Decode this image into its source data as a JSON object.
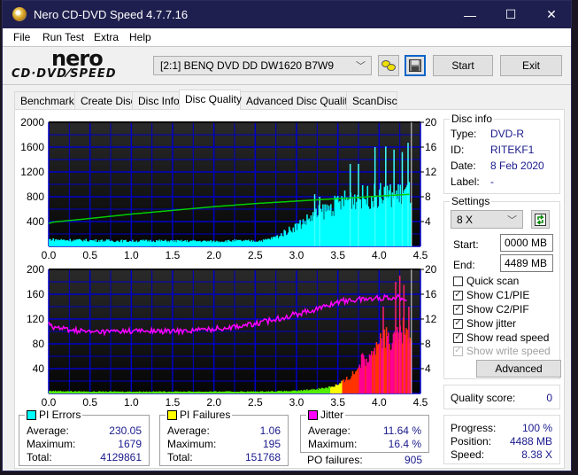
{
  "window": {
    "title": "Nero CD-DVD Speed 4.7.7.16",
    "controls": {
      "minimize": "—",
      "maximize": "☐",
      "close": "✕"
    }
  },
  "menu": [
    "File",
    "Run Test",
    "Extra",
    "Help"
  ],
  "logo": {
    "brand": "nero",
    "product": "CD·DVD⁄SPEED"
  },
  "toolbar": {
    "drive": "[2:1]   BENQ DVD DD DW1620 B7W9",
    "start_label": "Start",
    "exit_label": "Exit"
  },
  "tabs": [
    "Benchmark",
    "Create Disc",
    "Disc Info",
    "Disc Quality",
    "Advanced Disc Quality",
    "ScanDisc"
  ],
  "active_tab": "Disc Quality",
  "disc_info": {
    "title": "Disc info",
    "type_label": "Type:",
    "type": "DVD-R",
    "id_label": "ID:",
    "id": "RITEKF1",
    "date_label": "Date:",
    "date": "8 Feb 2020",
    "label_label": "Label:",
    "label": "-"
  },
  "settings": {
    "title": "Settings",
    "speed": "8 X",
    "start_label": "Start:",
    "start": "0000 MB",
    "end_label": "End:",
    "end": "4489 MB",
    "quick_scan": "Quick scan",
    "show_c1": "Show C1/PIE",
    "show_c2": "Show C2/PIF",
    "show_jitter": "Show jitter",
    "show_read": "Show read speed",
    "show_write": "Show write speed",
    "advanced_label": "Advanced"
  },
  "quality": {
    "label": "Quality score:",
    "value": "0"
  },
  "progress": {
    "progress_label": "Progress:",
    "progress": "100 %",
    "position_label": "Position:",
    "position": "4488 MB",
    "speed_label": "Speed:",
    "speed": "8.38 X"
  },
  "stats": {
    "pi_errors": {
      "title": "PI Errors",
      "color": "#00ffff",
      "avg_label": "Average:",
      "avg": "230.05",
      "max_label": "Maximum:",
      "max": "1679",
      "total_label": "Total:",
      "total": "4129861"
    },
    "pi_failures": {
      "title": "PI Failures",
      "color": "#ffff00",
      "avg_label": "Average:",
      "avg": "1.06",
      "max_label": "Maximum:",
      "max": "195",
      "total_label": "Total:",
      "total": "151768"
    },
    "jitter": {
      "title": "Jitter",
      "color": "#ff00ff",
      "avg_label": "Average:",
      "avg": "11.64 %",
      "max_label": "Maximum:",
      "max": "16.4 %"
    },
    "po_label": "PO failures:",
    "po": "905"
  },
  "chart_data": [
    {
      "type": "area",
      "title": "PI Errors",
      "x_ticks": [
        "0.0",
        "0.5",
        "1.0",
        "1.5",
        "2.0",
        "2.5",
        "3.0",
        "3.5",
        "4.0",
        "4.5"
      ],
      "xlim": [
        0,
        4.5
      ],
      "y_left_ticks": [
        "2000",
        "1600",
        "1200",
        "800",
        "400"
      ],
      "ylim_left": [
        0,
        2000
      ],
      "y_right_ticks": [
        "20",
        "16",
        "12",
        "8",
        "4"
      ],
      "ylim_right": [
        0,
        20
      ],
      "grid": true,
      "series": [
        {
          "name": "PI Errors",
          "color": "#00ffff",
          "axis": "left",
          "x": [
            0,
            0.25,
            0.5,
            0.75,
            1.0,
            1.25,
            1.5,
            1.75,
            2.0,
            2.25,
            2.5,
            2.6,
            2.7,
            2.8,
            2.9,
            3.0,
            3.1,
            3.2,
            3.3,
            3.4,
            3.5,
            3.6,
            3.7,
            3.8,
            3.9,
            4.0,
            4.1,
            4.2,
            4.3,
            4.38
          ],
          "values": [
            110,
            100,
            95,
            90,
            85,
            90,
            85,
            85,
            80,
            90,
            85,
            95,
            130,
            180,
            260,
            330,
            410,
            490,
            560,
            620,
            690,
            760,
            790,
            790,
            800,
            820,
            820,
            830,
            850,
            860
          ],
          "spikes": [
            [
              3.22,
              840
            ],
            [
              3.28,
              800
            ],
            [
              3.65,
              1330
            ],
            [
              3.75,
              1330
            ],
            [
              3.95,
              1600
            ],
            [
              4.08,
              1610
            ],
            [
              4.18,
              1560
            ],
            [
              4.28,
              1520
            ],
            [
              4.35,
              1670
            ]
          ]
        },
        {
          "name": "Read speed",
          "color": "#00cc00",
          "axis": "right",
          "x": [
            0,
            0.05,
            0.5,
            1.0,
            1.5,
            2.0,
            2.5,
            3.0,
            3.5,
            4.0,
            4.38
          ],
          "values": [
            3.7,
            3.9,
            4.5,
            5.2,
            5.8,
            6.4,
            6.9,
            7.3,
            7.7,
            8.1,
            8.4
          ]
        }
      ]
    },
    {
      "type": "area",
      "title": "PI Failures / Jitter",
      "x_ticks": [
        "0.0",
        "0.5",
        "1.0",
        "1.5",
        "2.0",
        "2.5",
        "3.0",
        "3.5",
        "4.0",
        "4.5"
      ],
      "xlim": [
        0,
        4.5
      ],
      "y_left_ticks": [
        "200",
        "160",
        "120",
        "80",
        "40"
      ],
      "ylim_left": [
        0,
        200
      ],
      "y_right_ticks": [
        "20",
        "16",
        "12",
        "8",
        "4"
      ],
      "ylim_right": [
        0,
        20
      ],
      "grid": true,
      "series": [
        {
          "name": "PI Failures",
          "color_gradient": [
            "#55ee00",
            "#ffff00",
            "#ff3300",
            "#ff0090"
          ],
          "axis": "left",
          "x": [
            0,
            0.5,
            1.0,
            1.5,
            2.0,
            2.5,
            3.0,
            3.3,
            3.5,
            3.6,
            3.7,
            3.8,
            3.9,
            4.0,
            4.1,
            4.2,
            4.3,
            4.38
          ],
          "values": [
            4,
            3,
            3,
            3,
            3,
            3,
            4,
            8,
            14,
            22,
            35,
            55,
            70,
            80,
            90,
            95,
            100,
            80
          ],
          "spikes": [
            [
              4.05,
              140
            ],
            [
              4.2,
              180
            ],
            [
              4.25,
              190
            ],
            [
              4.3,
              175
            ],
            [
              4.36,
              140
            ]
          ]
        },
        {
          "name": "Jitter",
          "color": "#ff00ff",
          "axis": "right",
          "x": [
            0,
            0.05,
            0.2,
            0.5,
            1.0,
            1.5,
            2.0,
            2.5,
            3.0,
            3.3,
            3.5,
            3.7,
            4.0,
            4.2,
            4.35
          ],
          "values": [
            11.8,
            10.6,
            10.4,
            9.9,
            10.1,
            10.0,
            10.4,
            11.2,
            12.8,
            13.8,
            14.8,
            15.1,
            15.4,
            15.5,
            15.4
          ]
        }
      ]
    }
  ]
}
